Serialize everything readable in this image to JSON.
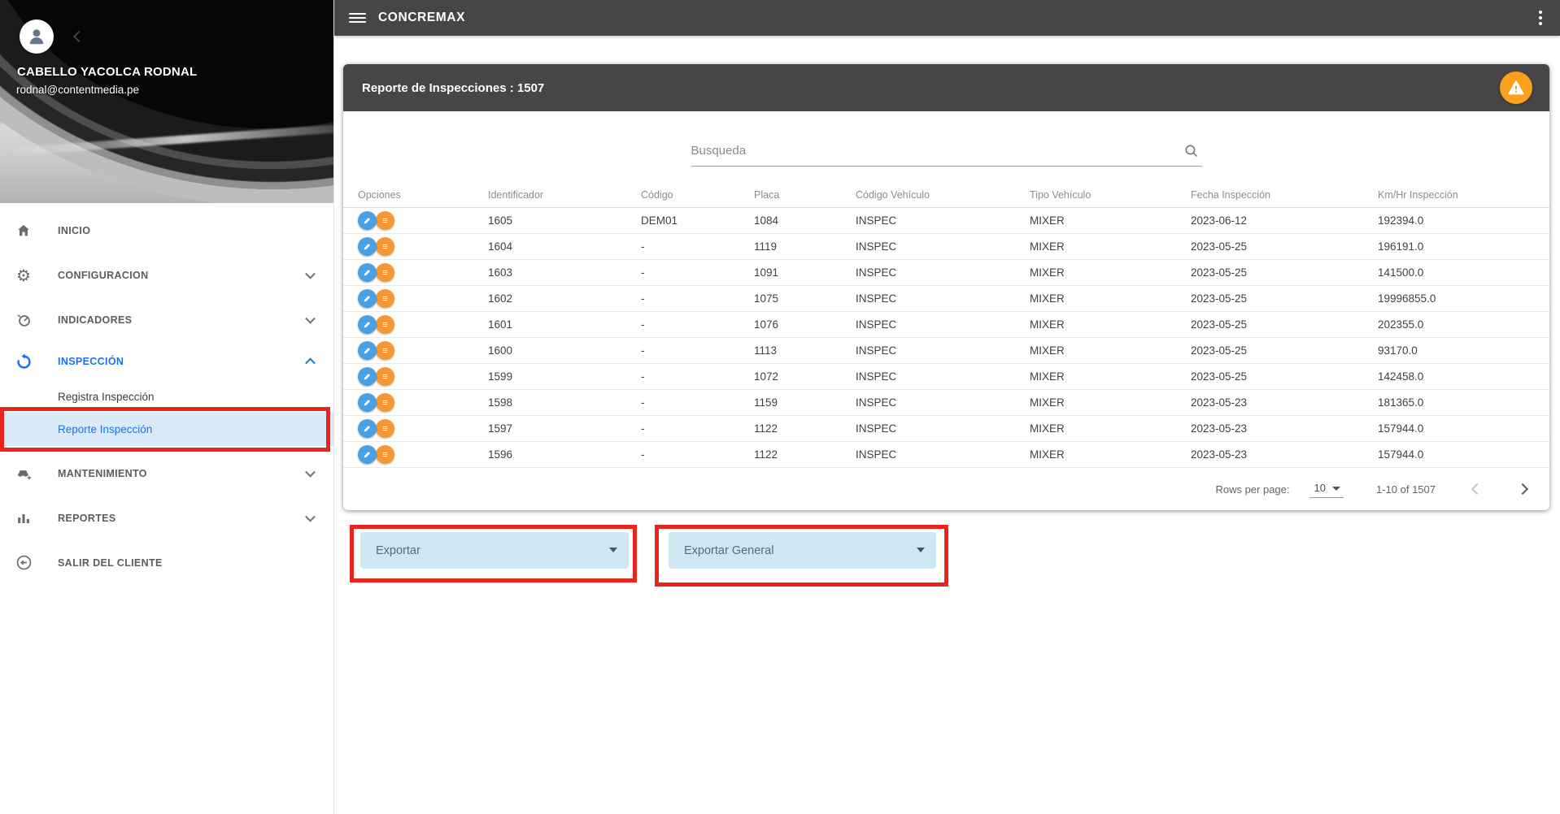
{
  "topbar": {
    "title": "CONCREMAX"
  },
  "user": {
    "name": "CABELLO YACOLCA RODNAL",
    "email": "rodnal@contentmedia.pe"
  },
  "sidebar": {
    "items": [
      {
        "label": "INICIO"
      },
      {
        "label": "CONFIGURACION"
      },
      {
        "label": "INDICADORES"
      },
      {
        "label": "INSPECCIÓN"
      },
      {
        "label": "MANTENIMIENTO"
      },
      {
        "label": "REPORTES"
      },
      {
        "label": "SALIR DEL CLIENTE"
      }
    ],
    "inspeccion_submenu": [
      {
        "label": "Registra Inspección"
      },
      {
        "label": "Reporte Inspección"
      }
    ]
  },
  "report": {
    "title": "Reporte de Inspecciones : 1507",
    "search_placeholder": "Busqueda",
    "columns": [
      "Opciones",
      "Identificador",
      "Código",
      "Placa",
      "Código Vehículo",
      "Tipo Vehículo",
      "Fecha Inspección",
      "Km/Hr Inspección"
    ],
    "rows": [
      {
        "identificador": "1605",
        "codigo": "DEM01",
        "placa": "1084",
        "codigo_vehiculo": "INSPEC",
        "tipo_vehiculo": "MIXER",
        "fecha": "2023-06-12",
        "km_hr": "192394.0"
      },
      {
        "identificador": "1604",
        "codigo": "-",
        "placa": "1119",
        "codigo_vehiculo": "INSPEC",
        "tipo_vehiculo": "MIXER",
        "fecha": "2023-05-25",
        "km_hr": "196191.0"
      },
      {
        "identificador": "1603",
        "codigo": "-",
        "placa": "1091",
        "codigo_vehiculo": "INSPEC",
        "tipo_vehiculo": "MIXER",
        "fecha": "2023-05-25",
        "km_hr": "141500.0"
      },
      {
        "identificador": "1602",
        "codigo": "-",
        "placa": "1075",
        "codigo_vehiculo": "INSPEC",
        "tipo_vehiculo": "MIXER",
        "fecha": "2023-05-25",
        "km_hr": "19996855.0"
      },
      {
        "identificador": "1601",
        "codigo": "-",
        "placa": "1076",
        "codigo_vehiculo": "INSPEC",
        "tipo_vehiculo": "MIXER",
        "fecha": "2023-05-25",
        "km_hr": "202355.0"
      },
      {
        "identificador": "1600",
        "codigo": "-",
        "placa": "1113",
        "codigo_vehiculo": "INSPEC",
        "tipo_vehiculo": "MIXER",
        "fecha": "2023-05-25",
        "km_hr": "93170.0"
      },
      {
        "identificador": "1599",
        "codigo": "-",
        "placa": "1072",
        "codigo_vehiculo": "INSPEC",
        "tipo_vehiculo": "MIXER",
        "fecha": "2023-05-25",
        "km_hr": "142458.0"
      },
      {
        "identificador": "1598",
        "codigo": "-",
        "placa": "1159",
        "codigo_vehiculo": "INSPEC",
        "tipo_vehiculo": "MIXER",
        "fecha": "2023-05-23",
        "km_hr": "181365.0"
      },
      {
        "identificador": "1597",
        "codigo": "-",
        "placa": "1122",
        "codigo_vehiculo": "INSPEC",
        "tipo_vehiculo": "MIXER",
        "fecha": "2023-05-23",
        "km_hr": "157944.0"
      },
      {
        "identificador": "1596",
        "codigo": "-",
        "placa": "1122",
        "codigo_vehiculo": "INSPEC",
        "tipo_vehiculo": "MIXER",
        "fecha": "2023-05-23",
        "km_hr": "157944.0"
      }
    ],
    "pagination": {
      "rows_per_page_label": "Rows per page:",
      "rows_per_page": "10",
      "range_label": "1-10 of 1507"
    }
  },
  "export": {
    "exportar_label": "Exportar",
    "exportar_general_label": "Exportar General"
  },
  "icons": {
    "menu": "hamburger",
    "more": "kebab-vertical",
    "inicio": "house",
    "configuracion": "gear",
    "indicadores": "gauge",
    "inspeccion": "sync",
    "mantenimiento": "car",
    "reportes": "bar-chart",
    "salir": "logout-arrow",
    "edit": "pencil",
    "details": "list-lines",
    "search": "magnifier",
    "warning": "triangle-exclamation",
    "avatar": "person",
    "collapse": "chevron-left"
  },
  "colors": {
    "topbar_bg": "#464646",
    "accent_blue": "#1a73e8",
    "edit_icon": "#4aa0e8",
    "list_icon": "#f89636",
    "warning_icon": "#f9a01c",
    "annotation_red": "#e8251c",
    "active_row_bg": "#dbeaf8",
    "export_bg": "#cfe7f3"
  }
}
